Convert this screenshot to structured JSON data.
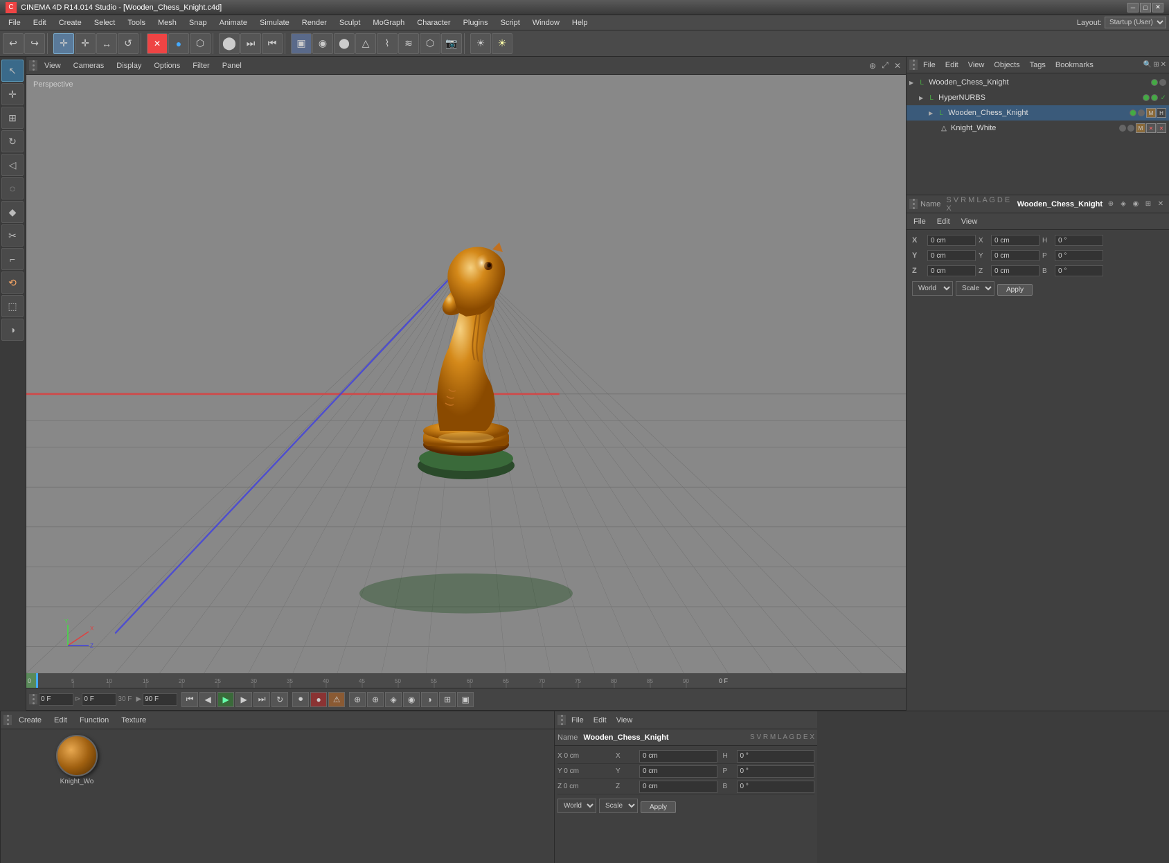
{
  "titlebar": {
    "icon": "C",
    "title": "CINEMA 4D R14.014 Studio - [Wooden_Chess_Knight.c4d]",
    "minimize": "─",
    "maximize": "□",
    "close": "✕"
  },
  "menubar": {
    "items": [
      "File",
      "Edit",
      "Create",
      "Select",
      "Tools",
      "Mesh",
      "Snap",
      "Animate",
      "Simulate",
      "Render",
      "Sculpt",
      "MoGraph",
      "Character",
      "Plugins",
      "Script",
      "Window",
      "Help"
    ]
  },
  "layout": {
    "label": "Layout:",
    "value": "Startup (User)"
  },
  "toolbar": {
    "buttons": [
      "↩",
      "↪",
      "⬛",
      "✛",
      "⬤",
      "↺",
      "✦",
      "✕",
      "⬤",
      "⬡",
      "⬣",
      "▣",
      "🎬",
      "⏭",
      "⏮",
      "⬡",
      "◈",
      "◉",
      "⬢",
      "⊕",
      "✦",
      "≋",
      "⬤",
      "☀"
    ]
  },
  "viewport": {
    "tabs": [
      "View",
      "Cameras",
      "Display",
      "Options",
      "Filter",
      "Panel"
    ],
    "label": "Perspective",
    "perspective": true
  },
  "objectManager": {
    "toolbar": [
      "File",
      "Edit",
      "View",
      "Objects",
      "Tags",
      "Bookmarks"
    ],
    "objects": [
      {
        "name": "Wooden_Chess_Knight",
        "indent": 0,
        "icon": "L",
        "iconColor": "green",
        "dots": [
          "green",
          "grey"
        ],
        "tags": []
      },
      {
        "name": "HyperNURBS",
        "indent": 1,
        "icon": "L",
        "iconColor": "green",
        "dots": [
          "green",
          "green"
        ],
        "tags": []
      },
      {
        "name": "Wooden_Chess_Knight",
        "indent": 2,
        "icon": "L",
        "iconColor": "green",
        "dots": [
          "green",
          "grey"
        ],
        "tags": [
          "mat",
          "hyp"
        ]
      },
      {
        "name": "Knight_White",
        "indent": 3,
        "icon": "△",
        "iconColor": "white",
        "dots": [
          "grey",
          "grey"
        ],
        "tags": [
          "mat",
          "x",
          "x"
        ]
      }
    ],
    "coordToolbar": [
      "File",
      "Edit",
      "View"
    ],
    "nameLabel": "Name",
    "selectedName": "Wooden_Chess_Knight"
  },
  "timeline": {
    "frameStart": "0 F",
    "frameEnd": "90 F",
    "fps": "30 F",
    "currentFrame": "0 F",
    "playbackFrame": "0 F",
    "ticks": [
      0,
      5,
      10,
      15,
      20,
      25,
      30,
      35,
      40,
      45,
      50,
      55,
      60,
      65,
      70,
      75,
      80,
      85,
      90
    ],
    "rightLabel": "0 F"
  },
  "materialEditor": {
    "toolbar": [
      "Create",
      "Edit",
      "Function",
      "Texture"
    ],
    "material": {
      "name": "Knight_Wo",
      "ballStyle": "wood"
    }
  },
  "coordManager": {
    "rows": [
      {
        "axis": "X",
        "pos": "0 cm",
        "rot": "X",
        "rotVal": "0 cm",
        "hpb": "H",
        "hpbVal": "0 °"
      },
      {
        "axis": "Y",
        "pos": "0 cm",
        "rot": "Y",
        "rotVal": "0 cm",
        "hpb": "P",
        "hpbVal": "0 °"
      },
      {
        "axis": "Z",
        "pos": "0 cm",
        "rot": "Z",
        "rotVal": "0 cm",
        "hpb": "B",
        "hpbVal": "0 °"
      }
    ],
    "worldLabel": "World",
    "scaleLabel": "Scale",
    "applyLabel": "Apply"
  },
  "bottomRightPanel": {
    "toolbar": [
      "File",
      "Edit",
      "View"
    ],
    "nameLabel": "Name",
    "selectedName": "Wooden_Chess_Knight",
    "coordRows": [
      {
        "axis": "X",
        "val1": "0 cm",
        "axis2": "X",
        "val2": "0 cm",
        "axis3": "H",
        "val3": "0 °"
      },
      {
        "axis": "Y",
        "val1": "0 cm",
        "axis2": "Y",
        "val2": "0 cm",
        "axis3": "P",
        "val3": "0 °"
      },
      {
        "axis": "Z",
        "val1": "0 cm",
        "axis2": "Z",
        "val2": "0 cm",
        "axis3": "B",
        "val3": "0 °"
      }
    ]
  },
  "colors": {
    "bg": "#3c3c3c",
    "panel": "#3a3a3a",
    "toolbar": "#444444",
    "highlight": "#5a8ab0",
    "accent": "#4a9f4a"
  }
}
